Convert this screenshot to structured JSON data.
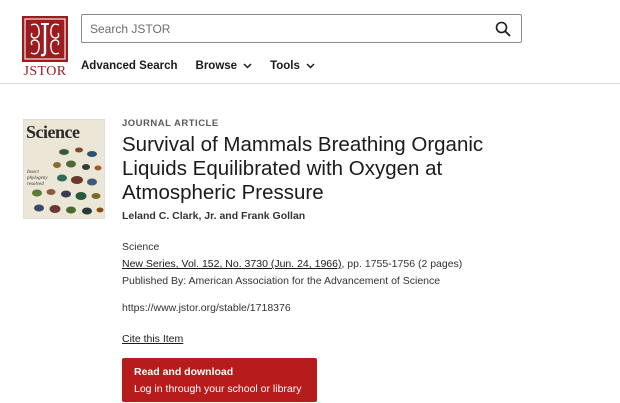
{
  "brand": {
    "logo_text": "JSTOR",
    "color": "#9b1b1e"
  },
  "search": {
    "placeholder": "Search JSTOR",
    "icon": "search-icon"
  },
  "nav": {
    "advanced_search": "Advanced Search",
    "browse": "Browse",
    "tools": "Tools"
  },
  "cover": {
    "title": "Science",
    "subtitle": "Insect phylogeny resolved"
  },
  "article": {
    "type_label": "JOURNAL ARTICLE",
    "title": "Survival of Mammals Breathing Organic Liquids Equilibrated with Oxygen at Atmospheric Pressure",
    "authors": "Leland C. Clark, Jr. and Frank Gollan",
    "journal": "Science",
    "issue_link": "New Series, Vol. 152, No. 3730 (Jun. 24, 1966)",
    "pages": ", pp. 1755-1756 (2 pages)",
    "publisher": "Published By: American Association for the Advancement of Science",
    "stable_url": "https://www.jstor.org/stable/1718376",
    "cite": "Cite this Item"
  },
  "download": {
    "primary": "Read and download",
    "secondary": "Log in through your school or library",
    "color": "#b71c1c"
  }
}
